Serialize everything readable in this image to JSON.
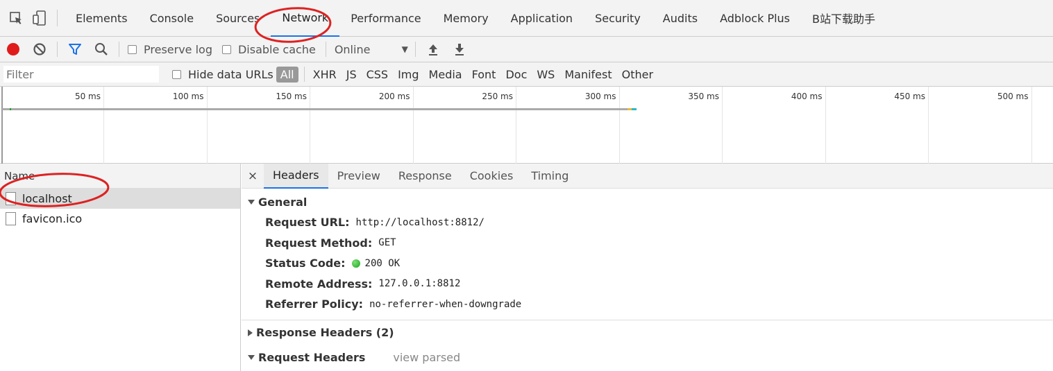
{
  "devtools": {
    "panel_tabs": [
      "Elements",
      "Console",
      "Sources",
      "Network",
      "Performance",
      "Memory",
      "Application",
      "Security",
      "Audits",
      "Adblock Plus",
      "B站下载助手"
    ],
    "active_panel": "Network"
  },
  "toolbar": {
    "preserve_log": "Preserve log",
    "disable_cache": "Disable cache",
    "throttle": "Online"
  },
  "filterbar": {
    "filter_placeholder": "Filter",
    "hide_data_urls": "Hide data URLs",
    "types": [
      "All",
      "XHR",
      "JS",
      "CSS",
      "Img",
      "Media",
      "Font",
      "Doc",
      "WS",
      "Manifest",
      "Other"
    ],
    "active_type": "All"
  },
  "timeline": {
    "ticks": [
      "50 ms",
      "100 ms",
      "150 ms",
      "200 ms",
      "250 ms",
      "300 ms",
      "350 ms",
      "400 ms",
      "450 ms",
      "500 ms"
    ]
  },
  "requests": {
    "column_name": "Name",
    "items": [
      "localhost",
      "favicon.ico"
    ],
    "selected": "localhost"
  },
  "detail": {
    "close": "×",
    "tabs": [
      "Headers",
      "Preview",
      "Response",
      "Cookies",
      "Timing"
    ],
    "active_tab": "Headers",
    "general": {
      "title": "General",
      "rows": [
        {
          "key": "Request URL:",
          "value": "http://localhost:8812/"
        },
        {
          "key": "Request Method:",
          "value": "GET"
        },
        {
          "key": "Status Code:",
          "value": "200 OK"
        },
        {
          "key": "Remote Address:",
          "value": "127.0.0.1:8812"
        },
        {
          "key": "Referrer Policy:",
          "value": "no-referrer-when-downgrade"
        }
      ]
    },
    "response_headers": "Response Headers (2)",
    "request_headers": "Request Headers",
    "view_parsed": "view parsed"
  },
  "colors": {
    "record": "#e01b1b",
    "accent": "#1a73e8",
    "annotation": "#dd2222",
    "status_ok": "#1aa51a"
  }
}
